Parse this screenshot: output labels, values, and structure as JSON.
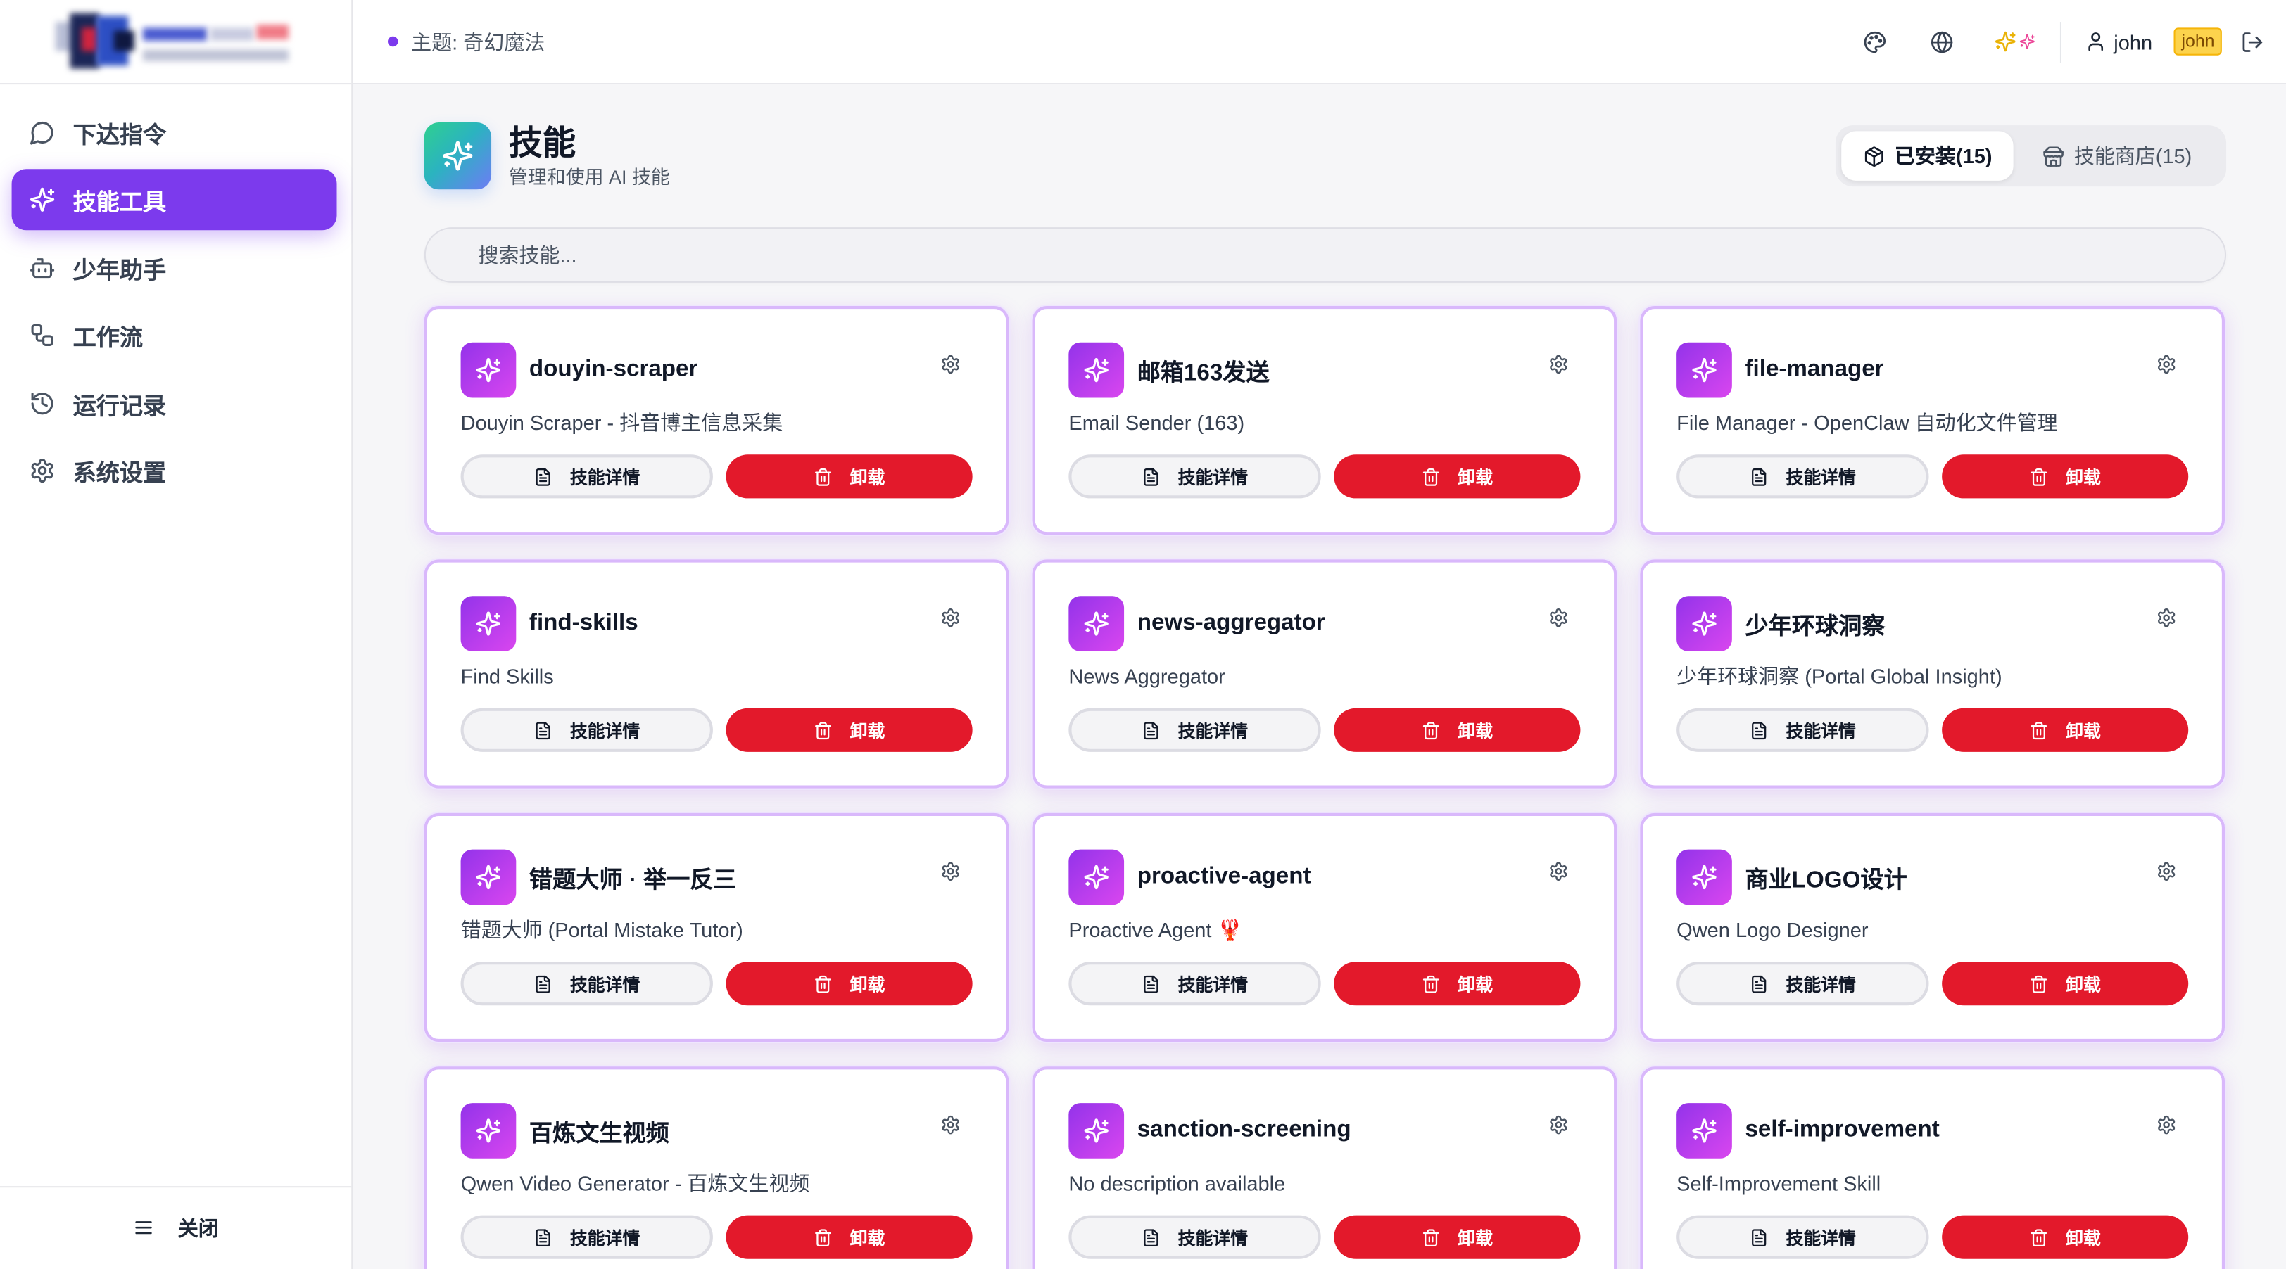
{
  "sidebar": {
    "items": [
      {
        "label": "下达指令",
        "icon": "message-circle-icon",
        "active": false
      },
      {
        "label": "技能工具",
        "icon": "sparkles-icon",
        "active": true
      },
      {
        "label": "少年助手",
        "icon": "bot-icon",
        "active": false
      },
      {
        "label": "工作流",
        "icon": "workflow-icon",
        "active": false
      },
      {
        "label": "运行记录",
        "icon": "history-icon",
        "active": false
      },
      {
        "label": "系统设置",
        "icon": "settings-icon",
        "active": false
      }
    ],
    "close": {
      "label": "关闭",
      "icon": "menu-icon"
    }
  },
  "header": {
    "theme_label": "主题: 奇幻魔法",
    "icons": {
      "palette": "palette-icon",
      "language": "globe-icon",
      "effects": "sparkles-icon",
      "user": "user-icon",
      "logout": "log-out-icon"
    },
    "username": "john",
    "user_badge": "john"
  },
  "page": {
    "title": "技能",
    "subtitle": "管理和使用 AI 技能",
    "title_icon": "sparkles-icon",
    "tabs": [
      {
        "label": "已安装(15)",
        "icon": "package-icon",
        "active": true
      },
      {
        "label": "技能商店(15)",
        "icon": "store-icon",
        "active": false
      }
    ],
    "search_placeholder": "搜索技能..."
  },
  "skills": {
    "detail_label": "技能详情",
    "uninstall_label": "卸载",
    "card_icon": "sparkles-icon",
    "items": [
      {
        "name": "douyin-scraper",
        "description": "Douyin Scraper - 抖音博主信息采集"
      },
      {
        "name": "邮箱163发送",
        "description": "Email Sender (163)"
      },
      {
        "name": "file-manager",
        "description": "File Manager - OpenClaw 自动化文件管理"
      },
      {
        "name": "find-skills",
        "description": "Find Skills"
      },
      {
        "name": "news-aggregator",
        "description": "News Aggregator"
      },
      {
        "name": "少年环球洞察",
        "description": "少年环球洞察 (Portal Global Insight)"
      },
      {
        "name": "错题大师 · 举一反三",
        "description": "错题大师 (Portal Mistake Tutor)"
      },
      {
        "name": "proactive-agent",
        "description": "Proactive Agent 🦞"
      },
      {
        "name": "商业LOGO设计",
        "description": "Qwen Logo Designer"
      },
      {
        "name": "百炼文生视频",
        "description": "Qwen Video Generator - 百炼文生视频"
      },
      {
        "name": "sanction-screening",
        "description": "No description available"
      },
      {
        "name": "self-improvement",
        "description": "Self-Improvement Skill"
      }
    ]
  },
  "colors": {
    "accent": "#7c3aed",
    "danger": "#e3192b",
    "card_border": "#d9b8fb",
    "skill_icon_from": "#9333ea",
    "skill_icon_to": "#d946ef",
    "badge": "#fcd34d",
    "effects_primary": "#eab308",
    "effects_secondary": "#ec4899"
  }
}
